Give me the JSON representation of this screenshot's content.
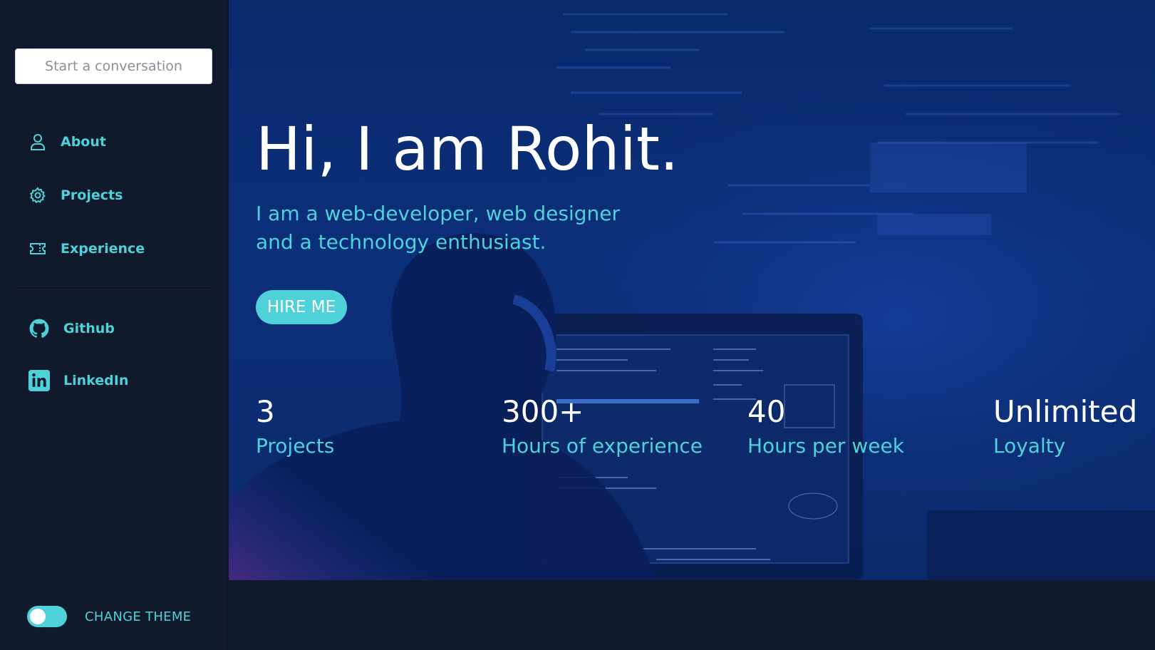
{
  "sidebar": {
    "search": {
      "placeholder": "Start a conversation"
    },
    "nav": [
      {
        "label": "About",
        "icon": "user-icon"
      },
      {
        "label": "Projects",
        "icon": "gear-icon"
      },
      {
        "label": "Experience",
        "icon": "ticket-icon"
      }
    ],
    "social": [
      {
        "label": "Github",
        "icon": "github-icon"
      },
      {
        "label": "LinkedIn",
        "icon": "linkedin-icon"
      }
    ],
    "theme": {
      "label": "CHANGE THEME",
      "enabled": true
    }
  },
  "hero": {
    "title": "Hi, I am Rohit.",
    "tagline": "I am a web-developer, web designer and a technology enthusiast.",
    "cta_label": "HIRE ME",
    "stats": [
      {
        "value": "3",
        "label": "Projects"
      },
      {
        "value": "300+",
        "label": "Hours of experience"
      },
      {
        "value": "40",
        "label": "Hours per week"
      },
      {
        "value": "Unlimited",
        "label": "Loyalty"
      }
    ]
  },
  "colors": {
    "accent": "#4fd1d9",
    "sidebar_bg": "#111a2d",
    "hero_bg": "#0c2f7a",
    "text_primary": "#ffffff"
  }
}
